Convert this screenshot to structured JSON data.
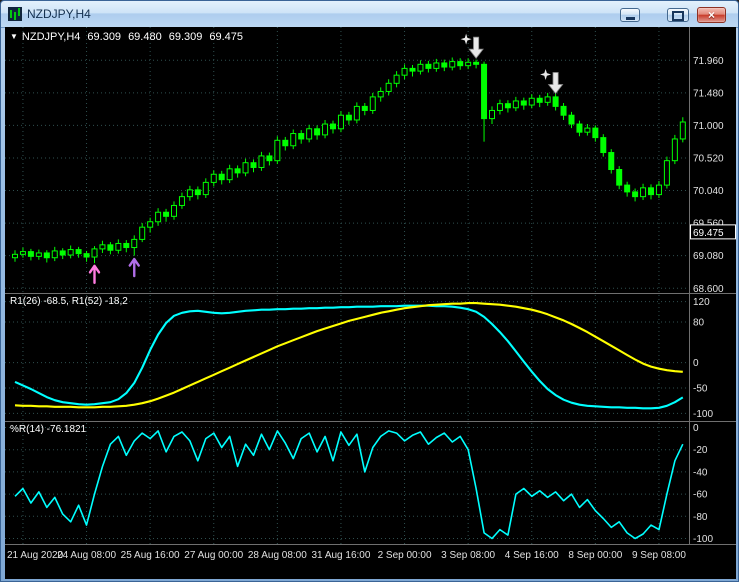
{
  "window": {
    "title": "NZDJPY,H4",
    "controls": {
      "minimize": "minimize",
      "maximize": "maximize",
      "close": "close",
      "close_glyph": "×"
    }
  },
  "chart": {
    "readout": {
      "dropdown": "▼",
      "symbol": "NZDJPY,H4",
      "open": "69.309",
      "high": "69.480",
      "low": "69.309",
      "close": "69.475"
    },
    "price_axis": {
      "labels": [
        "71.960",
        "71.480",
        "71.000",
        "70.520",
        "70.040",
        "69.560",
        "69.080",
        "68.600"
      ],
      "values": [
        71.96,
        71.48,
        71.0,
        70.52,
        70.04,
        69.56,
        69.08,
        68.6
      ],
      "current_label": "69.475",
      "current_value": 69.475
    },
    "time_axis": {
      "labels": [
        "21 Aug 2020",
        "24 Aug 08:00",
        "25 Aug 16:00",
        "27 Aug 00:00",
        "28 Aug 08:00",
        "31 Aug 16:00",
        "2 Sep 00:00",
        "3 Sep 08:00",
        "4 Sep 16:00",
        "8 Sep 00:00",
        "9 Sep 08:00"
      ]
    },
    "colors": {
      "background": "#000000",
      "grid": "#2f4f4f",
      "candle": "#00ff00",
      "bull_fill": "#000000",
      "bear_fill": "#00ff00",
      "axis_text": "#e0e0e0",
      "separator": "#6f6f6f",
      "cyan": "#00ffff",
      "yellow": "#ffff00"
    }
  },
  "chart_data": [
    {
      "type": "candlestick",
      "symbol": "NZDJPY",
      "timeframe": "H4",
      "y_range": [
        68.53,
        72.45
      ],
      "ohlc": [
        [
          69.05,
          69.16,
          68.99,
          69.1
        ],
        [
          69.1,
          69.2,
          69.05,
          69.14
        ],
        [
          69.14,
          69.18,
          69.01,
          69.07
        ],
        [
          69.07,
          69.17,
          69.02,
          69.12
        ],
        [
          69.12,
          69.16,
          68.98,
          69.05
        ],
        [
          69.05,
          69.21,
          69.0,
          69.15
        ],
        [
          69.15,
          69.19,
          69.03,
          69.09
        ],
        [
          69.09,
          69.23,
          69.04,
          69.17
        ],
        [
          69.17,
          69.21,
          69.05,
          69.11
        ],
        [
          69.11,
          69.15,
          68.99,
          69.06
        ],
        [
          69.06,
          69.22,
          68.97,
          69.18
        ],
        [
          69.18,
          69.3,
          69.12,
          69.24
        ],
        [
          69.24,
          69.28,
          69.1,
          69.16
        ],
        [
          69.16,
          69.32,
          69.11,
          69.26
        ],
        [
          69.26,
          69.31,
          69.13,
          69.2
        ],
        [
          69.2,
          69.38,
          69.08,
          69.32
        ],
        [
          69.32,
          69.56,
          69.28,
          69.5
        ],
        [
          69.5,
          69.64,
          69.42,
          69.58
        ],
        [
          69.58,
          69.78,
          69.52,
          69.72
        ],
        [
          69.72,
          69.77,
          69.58,
          69.66
        ],
        [
          69.66,
          69.88,
          69.61,
          69.82
        ],
        [
          69.82,
          70.01,
          69.77,
          69.95
        ],
        [
          69.95,
          70.11,
          69.89,
          70.05
        ],
        [
          70.05,
          70.1,
          69.91,
          69.98
        ],
        [
          69.98,
          70.22,
          69.93,
          70.16
        ],
        [
          70.16,
          70.34,
          70.1,
          70.28
        ],
        [
          70.28,
          70.33,
          70.13,
          70.2
        ],
        [
          70.2,
          70.42,
          70.15,
          70.36
        ],
        [
          70.36,
          70.41,
          70.23,
          70.3
        ],
        [
          70.3,
          70.51,
          70.25,
          70.45
        ],
        [
          70.45,
          70.5,
          70.31,
          70.38
        ],
        [
          70.38,
          70.61,
          70.33,
          70.55
        ],
        [
          70.55,
          70.6,
          70.41,
          70.48
        ],
        [
          70.48,
          70.84,
          70.43,
          70.78
        ],
        [
          70.78,
          70.83,
          70.63,
          70.7
        ],
        [
          70.7,
          70.94,
          70.65,
          70.88
        ],
        [
          70.88,
          70.93,
          70.73,
          70.8
        ],
        [
          70.8,
          71.01,
          70.75,
          70.95
        ],
        [
          70.95,
          71.0,
          70.79,
          70.86
        ],
        [
          70.86,
          71.08,
          70.81,
          71.02
        ],
        [
          71.02,
          71.07,
          70.88,
          70.95
        ],
        [
          70.95,
          71.21,
          70.9,
          71.15
        ],
        [
          71.15,
          71.2,
          71.01,
          71.08
        ],
        [
          71.08,
          71.34,
          71.03,
          71.28
        ],
        [
          71.28,
          71.33,
          71.15,
          71.22
        ],
        [
          71.22,
          71.48,
          71.17,
          71.42
        ],
        [
          71.42,
          71.56,
          71.35,
          71.5
        ],
        [
          71.5,
          71.68,
          71.44,
          71.62
        ],
        [
          71.62,
          71.8,
          71.56,
          71.74
        ],
        [
          71.74,
          71.9,
          71.68,
          71.84
        ],
        [
          71.84,
          71.89,
          71.72,
          71.8
        ],
        [
          71.8,
          71.96,
          71.75,
          71.9
        ],
        [
          71.9,
          71.95,
          71.78,
          71.84
        ],
        [
          71.84,
          71.98,
          71.79,
          71.92
        ],
        [
          71.92,
          71.97,
          71.8,
          71.86
        ],
        [
          71.86,
          72.0,
          71.81,
          71.94
        ],
        [
          71.94,
          71.99,
          71.82,
          71.88
        ],
        [
          71.88,
          71.99,
          71.83,
          71.93
        ],
        [
          71.93,
          71.97,
          71.84,
          71.9
        ],
        [
          71.9,
          71.94,
          70.76,
          71.1
        ],
        [
          71.1,
          71.28,
          71.02,
          71.22
        ],
        [
          71.22,
          71.38,
          71.16,
          71.32
        ],
        [
          71.32,
          71.37,
          71.19,
          71.26
        ],
        [
          71.26,
          71.42,
          71.21,
          71.36
        ],
        [
          71.36,
          71.41,
          71.23,
          71.3
        ],
        [
          71.3,
          71.46,
          71.25,
          71.4
        ],
        [
          71.4,
          71.45,
          71.27,
          71.34
        ],
        [
          71.34,
          71.48,
          71.29,
          71.42
        ],
        [
          71.42,
          71.47,
          71.22,
          71.28
        ],
        [
          71.28,
          71.33,
          71.08,
          71.15
        ],
        [
          71.15,
          71.2,
          70.96,
          71.02
        ],
        [
          71.02,
          71.07,
          70.84,
          70.9
        ],
        [
          70.9,
          71.02,
          70.85,
          70.96
        ],
        [
          70.96,
          71.0,
          70.76,
          70.82
        ],
        [
          70.82,
          70.87,
          70.54,
          70.6
        ],
        [
          70.6,
          70.65,
          70.29,
          70.35
        ],
        [
          70.35,
          70.4,
          70.06,
          70.12
        ],
        [
          70.12,
          70.17,
          69.95,
          70.02
        ],
        [
          70.02,
          70.07,
          69.88,
          69.95
        ],
        [
          69.95,
          70.14,
          69.9,
          70.08
        ],
        [
          70.08,
          70.13,
          69.91,
          69.98
        ],
        [
          69.98,
          70.18,
          69.93,
          70.12
        ],
        [
          70.12,
          70.54,
          70.07,
          70.48
        ],
        [
          70.48,
          70.86,
          70.43,
          70.8
        ],
        [
          70.8,
          71.12,
          70.75,
          71.05
        ]
      ],
      "signals": {
        "buy_arrows": [
          {
            "index": 10,
            "price": 68.93,
            "color": "#ff7be0"
          },
          {
            "index": 15,
            "price": 69.03,
            "color": "#b06ee8"
          }
        ],
        "sell_arrows": [
          {
            "index": 58,
            "price": 72.3,
            "color": "#e8e8e8",
            "star": true
          },
          {
            "index": 68,
            "price": 71.78,
            "color": "#e8e8e8",
            "star": true
          }
        ]
      }
    },
    {
      "type": "line",
      "title": "R1(26) -68.5, R1(52) -18,2",
      "y_range": [
        -115,
        135
      ],
      "gridlines": [
        120,
        80,
        0,
        -50,
        -100
      ],
      "series": [
        {
          "name": "R1(26)",
          "color": "#00ffff",
          "values": [
            -38,
            -45,
            -52,
            -60,
            -68,
            -74,
            -78,
            -80,
            -82,
            -83,
            -82,
            -80,
            -78,
            -72,
            -60,
            -40,
            -10,
            25,
            55,
            78,
            92,
            98,
            101,
            102,
            100,
            98,
            97,
            98,
            100,
            102,
            103,
            104,
            104,
            105,
            105,
            106,
            106,
            107,
            107,
            108,
            108,
            109,
            109,
            110,
            110,
            110,
            111,
            111,
            111,
            112,
            112,
            112,
            112,
            111,
            111,
            110,
            108,
            105,
            100,
            90,
            76,
            60,
            42,
            22,
            2,
            -18,
            -36,
            -52,
            -64,
            -73,
            -79,
            -83,
            -85,
            -86,
            -87,
            -88,
            -88,
            -89,
            -89,
            -90,
            -90,
            -89,
            -85,
            -78,
            -68.5
          ]
        },
        {
          "name": "R1(52)",
          "color": "#ffff00",
          "values": [
            -84,
            -85,
            -85,
            -86,
            -86,
            -87,
            -87,
            -87,
            -88,
            -88,
            -88,
            -87,
            -87,
            -86,
            -85,
            -83,
            -80,
            -76,
            -71,
            -65,
            -59,
            -52,
            -45,
            -38,
            -31,
            -24,
            -17,
            -10,
            -3,
            4,
            11,
            18,
            25,
            32,
            38,
            44,
            50,
            56,
            62,
            67,
            72,
            77,
            82,
            86,
            90,
            94,
            98,
            101,
            104,
            107,
            109,
            111,
            113,
            114,
            115,
            116,
            116,
            117,
            117,
            116,
            115,
            114,
            112,
            110,
            107,
            104,
            100,
            95,
            89,
            83,
            76,
            68,
            60,
            51,
            42,
            33,
            24,
            15,
            6,
            -2,
            -8,
            -12,
            -15,
            -17,
            -18.2
          ]
        }
      ]
    },
    {
      "type": "line",
      "title": "%R(14) -76.1821",
      "y_range": [
        -105,
        5
      ],
      "gridlines": [
        0,
        -20,
        -40,
        -60,
        -80,
        -100
      ],
      "series": [
        {
          "name": "%R(14)",
          "color": "#00ffff",
          "values": [
            -62,
            -55,
            -68,
            -58,
            -72,
            -63,
            -78,
            -85,
            -70,
            -88,
            -60,
            -35,
            -15,
            -8,
            -25,
            -12,
            -5,
            -10,
            -3,
            -22,
            -8,
            -4,
            -12,
            -30,
            -10,
            -5,
            -18,
            -8,
            -35,
            -15,
            -25,
            -6,
            -20,
            -3,
            -14,
            -28,
            -10,
            -5,
            -22,
            -8,
            -30,
            -4,
            -16,
            -6,
            -40,
            -18,
            -8,
            -3,
            -5,
            -12,
            -7,
            -4,
            -15,
            -9,
            -5,
            -13,
            -8,
            -20,
            -55,
            -95,
            -100,
            -92,
            -97,
            -60,
            -55,
            -62,
            -57,
            -63,
            -58,
            -66,
            -60,
            -72,
            -65,
            -75,
            -82,
            -90,
            -85,
            -95,
            -100,
            -96,
            -88,
            -92,
            -60,
            -30,
            -15
          ]
        }
      ]
    }
  ]
}
